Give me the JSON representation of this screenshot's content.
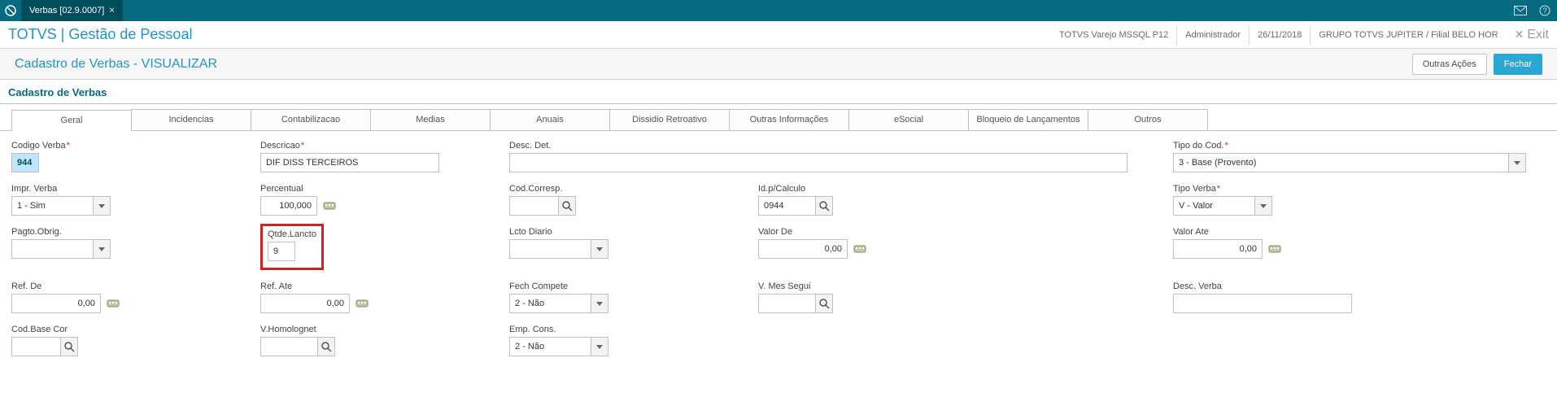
{
  "titlebar": {
    "tab_label": "Verbas [02.9.0007]"
  },
  "subbar": {
    "product": "TOTVS | Gestão de Pessoal",
    "env": "TOTVS Varejo MSSQL P12",
    "user": "Administrador",
    "date": "26/11/2018",
    "branch": "GRUPO TOTVS JUPITER / Filial BELO HOR",
    "exit": "Exit"
  },
  "pagehdr": {
    "title": "Cadastro de Verbas - VISUALIZAR",
    "other_actions": "Outras Ações",
    "close": "Fechar"
  },
  "section_title": "Cadastro de Verbas",
  "tabs": [
    "Geral",
    "Incidencias",
    "Contabilizacao",
    "Medias",
    "Anuais",
    "Dissidio Retroativo",
    "Outras Informações",
    "eSocial",
    "Bloqueio de Lançamentos",
    "Outros"
  ],
  "form": {
    "codigo_verba": {
      "label": "Codigo Verba",
      "value": "944"
    },
    "descricao": {
      "label": "Descricao",
      "value": "DIF DISS TERCEIROS"
    },
    "desc_det": {
      "label": "Desc. Det.",
      "value": ""
    },
    "tipo_cod": {
      "label": "Tipo do Cod.",
      "value": "3 - Base (Provento)"
    },
    "impr_verba": {
      "label": "Impr. Verba",
      "value": "1 - Sim"
    },
    "percentual": {
      "label": "Percentual",
      "value": "100,000"
    },
    "cod_corresp": {
      "label": "Cod.Corresp.",
      "value": ""
    },
    "id_calculo": {
      "label": "Id.p/Calculo",
      "value": "0944"
    },
    "tipo_verba": {
      "label": "Tipo Verba",
      "value": "V - Valor"
    },
    "pagto_obrig": {
      "label": "Pagto.Obrig.",
      "value": ""
    },
    "qtde_lancto": {
      "label": "Qtde.Lancto",
      "value": "9"
    },
    "lcto_diario": {
      "label": "Lcto Diario",
      "value": ""
    },
    "valor_de": {
      "label": "Valor De",
      "value": "0,00"
    },
    "valor_ate": {
      "label": "Valor Ate",
      "value": "0,00"
    },
    "ref_de": {
      "label": "Ref. De",
      "value": "0,00"
    },
    "ref_ate": {
      "label": "Ref. Ate",
      "value": "0,00"
    },
    "fech_compete": {
      "label": "Fech Compete",
      "value": "2 - Não"
    },
    "v_mes_segui": {
      "label": "V. Mes Segui",
      "value": ""
    },
    "desc_verba": {
      "label": "Desc. Verba",
      "value": ""
    },
    "cod_base_cor": {
      "label": "Cod.Base Cor",
      "value": ""
    },
    "v_homolognet": {
      "label": "V.Homolognet",
      "value": ""
    },
    "emp_cons": {
      "label": "Emp. Cons.",
      "value": "2 - Não"
    }
  }
}
